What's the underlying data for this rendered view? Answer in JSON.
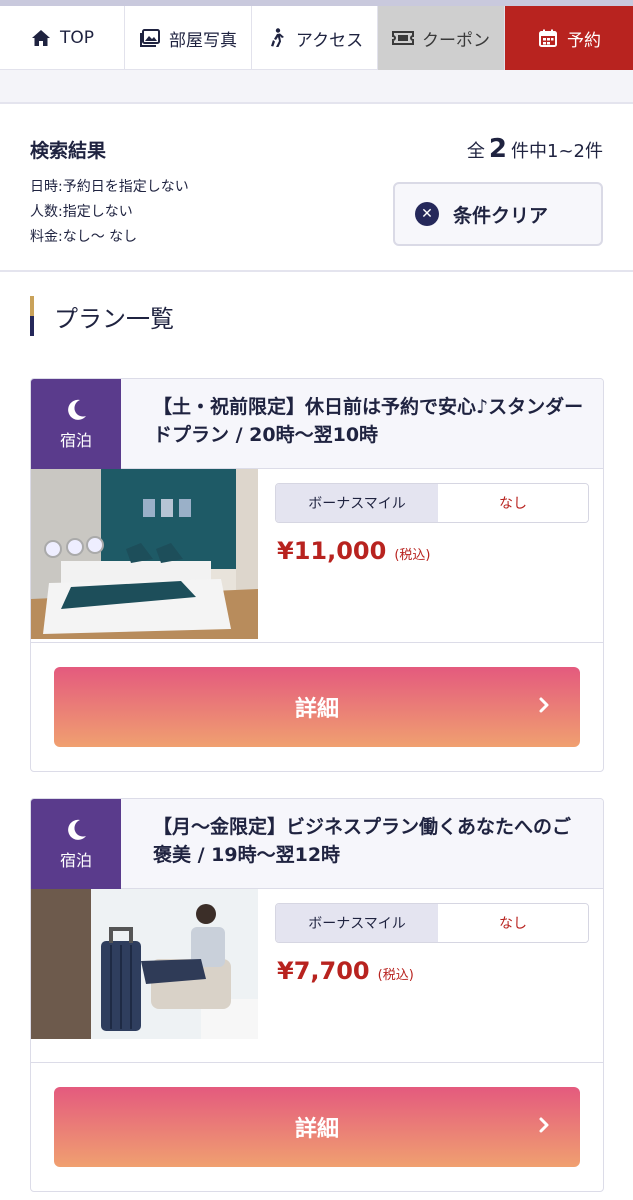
{
  "nav": {
    "top": "TOP",
    "photo": "部屋写真",
    "access": "アクセス",
    "coupon": "クーポン",
    "reserve": "予約"
  },
  "search": {
    "title": "検索結果",
    "date": "日時:予約日を指定しない",
    "people": "人数:指定しない",
    "price": "料金:なし〜 なし",
    "count_prefix": "全",
    "count_total": "2",
    "count_suffix": "件中1~2件",
    "clear_label": "条件クリア"
  },
  "plans": {
    "heading": "プラン一覧",
    "items": [
      {
        "badge": "宿泊",
        "title": "【土・祝前限定】休日前は予約で安心♪スタンダードプラン / 20時〜翌10時",
        "mile_label": "ボーナスマイル",
        "mile_value": "なし",
        "price": "¥11,000",
        "tax": "(税込)",
        "detail": "詳細"
      },
      {
        "badge": "宿泊",
        "title": "【月〜金限定】ビジネスプラン働くあなたへのご褒美 / 19時〜翌12時",
        "mile_label": "ボーナスマイル",
        "mile_value": "なし",
        "price": "¥7,700",
        "tax": "(税込)",
        "detail": "詳細"
      }
    ]
  },
  "colors": {
    "accent_red": "#b8231f",
    "badge_purple": "#5a3b8c",
    "navy": "#25285a",
    "button_gradient_top": "#e45a7e",
    "button_gradient_bottom": "#f0a070"
  }
}
